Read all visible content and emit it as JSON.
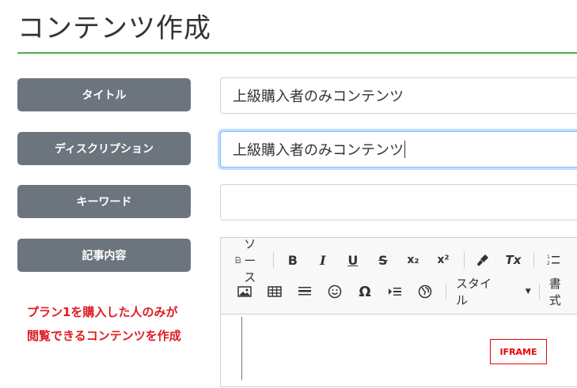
{
  "page": {
    "title": "コンテンツ作成"
  },
  "form": {
    "title_label": "タイトル",
    "title_value": "上級購入者のみコンテンツ",
    "description_label": "ディスクリプション",
    "description_value": "上級購入者のみコンテンツ",
    "keywords_label": "キーワード",
    "keywords_value": "",
    "article_label": "記事内容"
  },
  "editor": {
    "source_label": "ソース",
    "bold": "B",
    "italic": "I",
    "underline": "U",
    "strike": "S",
    "subscript": "x₂",
    "superscript": "x²",
    "clear_format": "Tx",
    "style_label": "スタイル",
    "format_label": "書式",
    "special_char": "Ω",
    "iframe_placeholder": "IFRAME"
  },
  "note": {
    "line1": "プラン1を購入した人のみが",
    "line2": "閲覧できるコンテンツを作成"
  }
}
